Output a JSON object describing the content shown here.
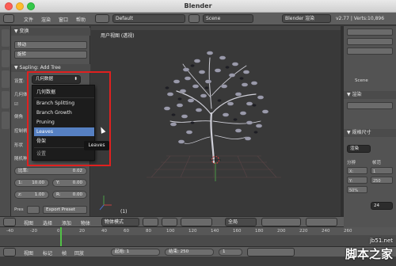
{
  "window": {
    "title": "Blender"
  },
  "menubar": {
    "items": [
      "文件",
      "渲染",
      "窗口",
      "帮助"
    ],
    "layout": "Default",
    "scene": "Scene",
    "engine": "Blender 渲染",
    "version": "v2.77 | Verts:10,896"
  },
  "left_panel": {
    "transform_header": "▼ 变换",
    "move": "移动",
    "rotate": "旋转",
    "sapling_header": "▼ Sapling: Add Tree",
    "settings_label": "设置:",
    "settings_value": "几何数据",
    "geometry_label": "几何体",
    "clip_label": "倒角",
    "control_label": "控制柄",
    "shape_label": "形状",
    "random_label": "随机种",
    "ratio_label": "比率:",
    "ratio_value": "0.02",
    "scale_a_label": "1:",
    "scale_a_value": "10.00",
    "scale_b_label": "Y:",
    "scale_b_value": "0.00",
    "scale_c_label": "z:",
    "scale_c_value": "1.00",
    "scale_d_label": "R:",
    "scale_d_value": "0.00",
    "preset_label": "Pres",
    "export_preset": "Export Preset"
  },
  "dropdown": {
    "items": [
      "几何数据",
      "Branch Splitting",
      "Branch Growth",
      "Pruning",
      "Leaves",
      "骨架",
      "设置"
    ],
    "active": "Leaves",
    "tooltip": "Leaves"
  },
  "viewport": {
    "label": "用户视图 (透视)",
    "frame": "(1)"
  },
  "right_panel": {
    "scene_label": "Scene",
    "render_header": "▼ 渲染",
    "dimensions_header": "▼ 规格尺寸",
    "render_button": "渲染",
    "resolution": "分辨",
    "frame_range": "帧范",
    "x_label": "X:",
    "y_label": "Y:",
    "frame_rate": "24",
    "frame_start": "1",
    "frame_end": "250",
    "pct": "50%"
  },
  "viewport_header": {
    "view": "视图",
    "select": "选择",
    "add": "添加",
    "object": "物体",
    "mode": "物体模式",
    "global": "全局"
  },
  "timeline": {
    "ticks": [
      "-40",
      "-20",
      "0",
      "20",
      "40",
      "60",
      "80",
      "100",
      "120",
      "140",
      "160",
      "180",
      "200",
      "220",
      "240",
      "260"
    ],
    "view": "视图",
    "marker": "标记",
    "frame": "帧",
    "playback": "回放",
    "start_label": "起始:",
    "start_value": "1",
    "end_label": "结束:",
    "end_value": "250",
    "current": "1"
  },
  "watermark": {
    "site": "jb51.net",
    "brand": "脚本之家"
  }
}
